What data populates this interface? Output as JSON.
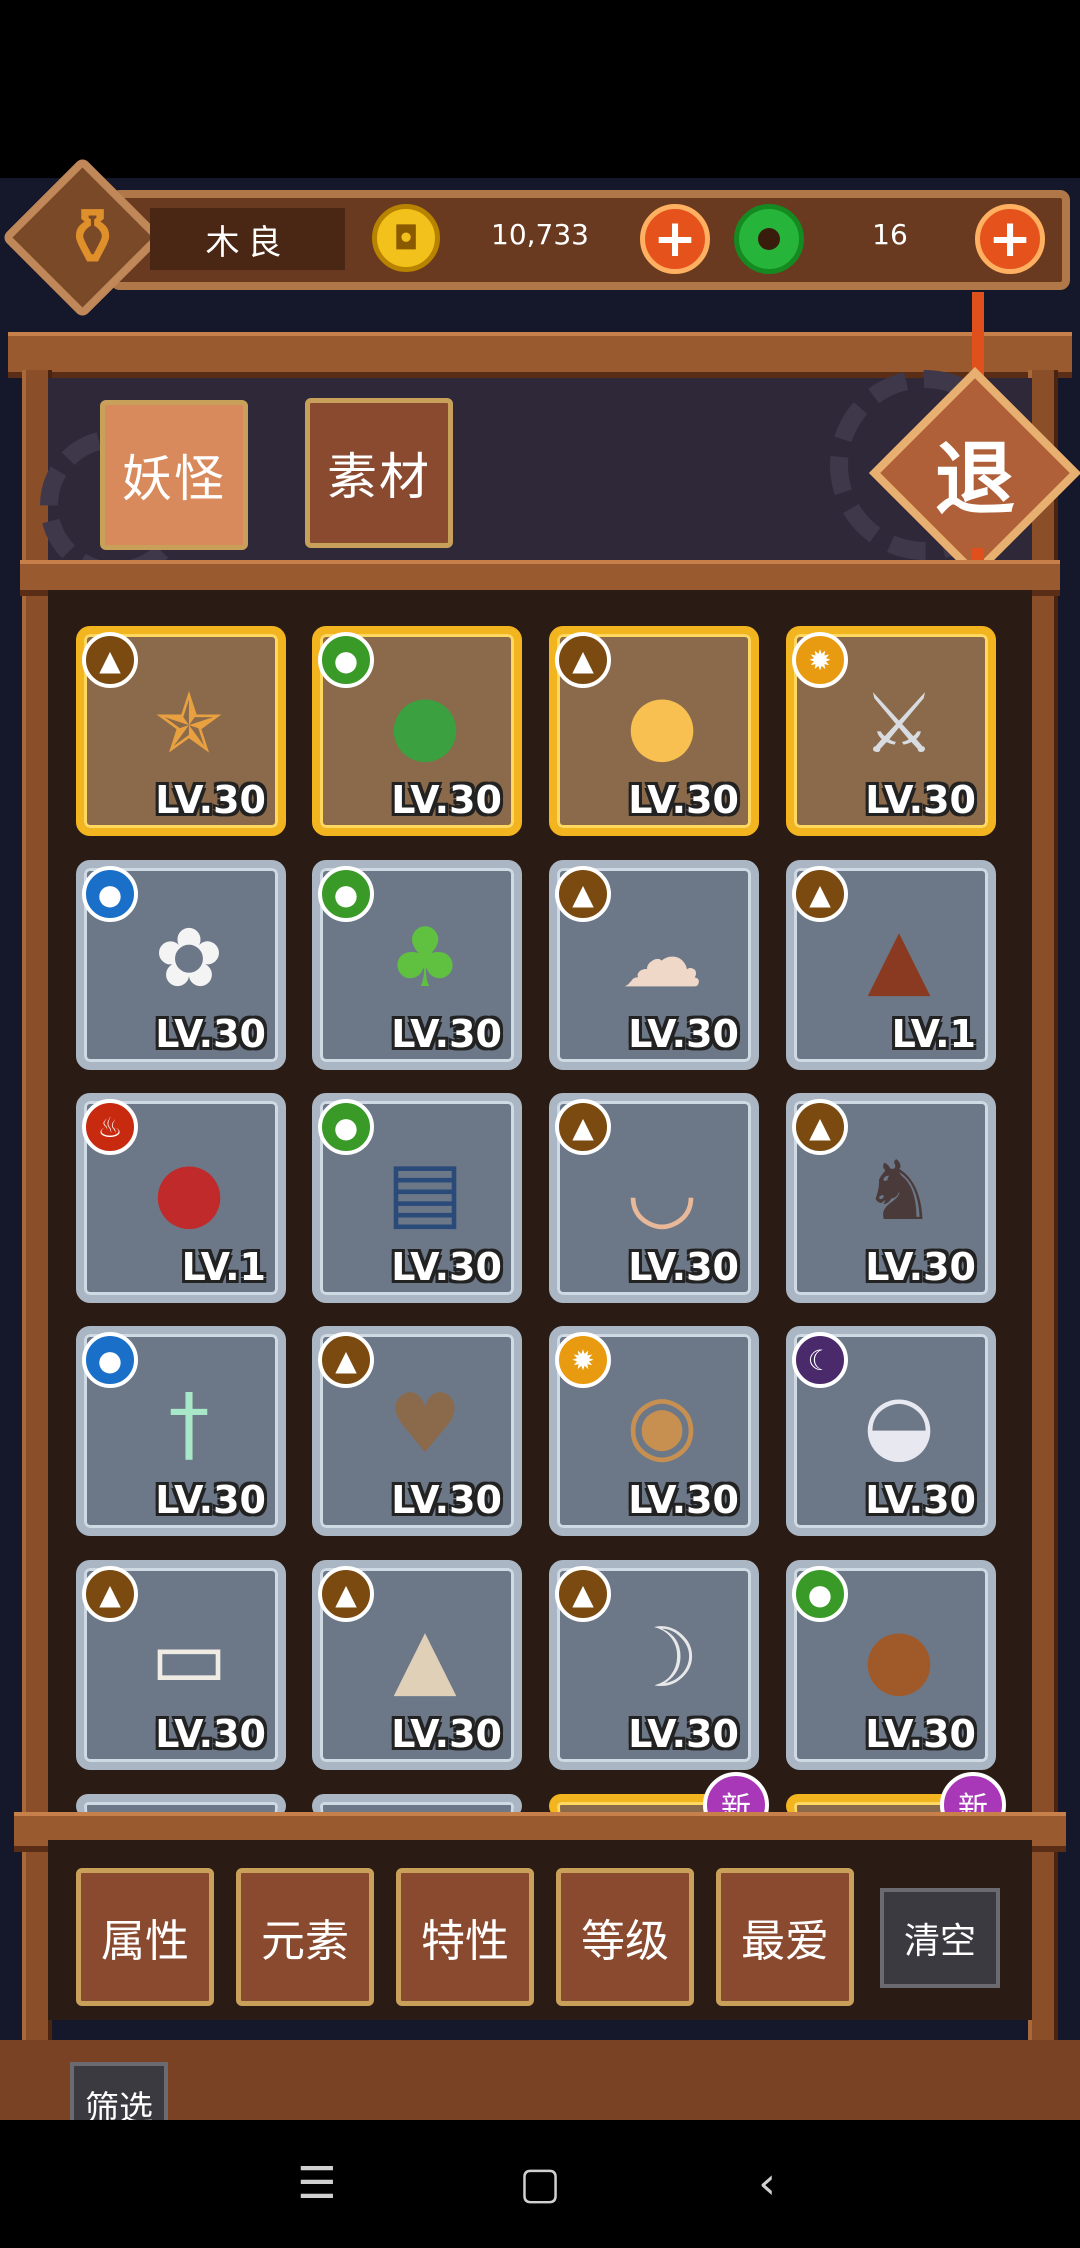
{
  "header": {
    "player_name": "木良",
    "coins": "10,733",
    "jade": "16",
    "add_coins_label": "+",
    "add_jade_label": "+"
  },
  "tabs": [
    {
      "label": "妖怪",
      "active": true
    },
    {
      "label": "素材",
      "active": false
    }
  ],
  "exit_label": "退",
  "cards": [
    {
      "element": "earth",
      "element_glyph": "▲",
      "sprite_glyph": "✯",
      "sprite_color": "#e8a040",
      "level": "LV.30",
      "frame": "gold"
    },
    {
      "element": "wood",
      "element_glyph": "●",
      "sprite_glyph": "●",
      "sprite_color": "#3aa040",
      "level": "LV.30",
      "frame": "gold"
    },
    {
      "element": "earth",
      "element_glyph": "▲",
      "sprite_glyph": "●",
      "sprite_color": "#f8c050",
      "level": "LV.30",
      "frame": "gold"
    },
    {
      "element": "sun",
      "element_glyph": "✹",
      "sprite_glyph": "⚔",
      "sprite_color": "#d8dce0",
      "level": "LV.30",
      "frame": "gold"
    },
    {
      "element": "water",
      "element_glyph": "●",
      "sprite_glyph": "✿",
      "sprite_color": "#f4f4f4",
      "level": "LV.30",
      "frame": "silver"
    },
    {
      "element": "wood",
      "element_glyph": "●",
      "sprite_glyph": "♣",
      "sprite_color": "#60c040",
      "level": "LV.30",
      "frame": "silver"
    },
    {
      "element": "earth",
      "element_glyph": "▲",
      "sprite_glyph": "☁",
      "sprite_color": "#f0d8c8",
      "level": "LV.30",
      "frame": "silver"
    },
    {
      "element": "earth",
      "element_glyph": "▲",
      "sprite_glyph": "▲",
      "sprite_color": "#8a3a20",
      "level": "LV.1",
      "frame": "silver"
    },
    {
      "element": "fire",
      "element_glyph": "♨",
      "sprite_glyph": "●",
      "sprite_color": "#c02a2a",
      "level": "LV.1",
      "frame": "silver"
    },
    {
      "element": "wood",
      "element_glyph": "●",
      "sprite_glyph": "▤",
      "sprite_color": "#2a4a7a",
      "level": "LV.30",
      "frame": "silver"
    },
    {
      "element": "earth",
      "element_glyph": "▲",
      "sprite_glyph": "◡",
      "sprite_color": "#e8b898",
      "level": "LV.30",
      "frame": "silver"
    },
    {
      "element": "earth",
      "element_glyph": "▲",
      "sprite_glyph": "♞",
      "sprite_color": "#4a3a3a",
      "level": "LV.30",
      "frame": "silver"
    },
    {
      "element": "water",
      "element_glyph": "●",
      "sprite_glyph": "†",
      "sprite_color": "#a8e8c8",
      "level": "LV.30",
      "frame": "silver"
    },
    {
      "element": "earth",
      "element_glyph": "▲",
      "sprite_glyph": "♥",
      "sprite_color": "#8a6a4a",
      "level": "LV.30",
      "frame": "silver"
    },
    {
      "element": "sun",
      "element_glyph": "✹",
      "sprite_glyph": "◉",
      "sprite_color": "#c89050",
      "level": "LV.30",
      "frame": "silver"
    },
    {
      "element": "moon",
      "element_glyph": "☾",
      "sprite_glyph": "◒",
      "sprite_color": "#e8e8f0",
      "level": "LV.30",
      "frame": "silver"
    },
    {
      "element": "earth",
      "element_glyph": "▲",
      "sprite_glyph": "▭",
      "sprite_color": "#f0ece4",
      "level": "LV.30",
      "frame": "silver"
    },
    {
      "element": "earth",
      "element_glyph": "▲",
      "sprite_glyph": "▲",
      "sprite_color": "#e0d0b8",
      "level": "LV.30",
      "frame": "silver"
    },
    {
      "element": "earth",
      "element_glyph": "▲",
      "sprite_glyph": "☽",
      "sprite_color": "#e8e8e8",
      "level": "LV.30",
      "frame": "silver"
    },
    {
      "element": "wood",
      "element_glyph": "●",
      "sprite_glyph": "●",
      "sprite_color": "#a05a2a",
      "level": "LV.30",
      "frame": "silver"
    }
  ],
  "partial_row": [
    {
      "new_badge": ""
    },
    {
      "new_badge": ""
    },
    {
      "new_badge": "新"
    },
    {
      "new_badge": "新"
    }
  ],
  "filters": [
    {
      "label": "属性"
    },
    {
      "label": "元素"
    },
    {
      "label": "特性"
    },
    {
      "label": "等级"
    },
    {
      "label": "最爱"
    }
  ],
  "clear_label": "清空",
  "screen_label": "筛选",
  "navbar": {
    "menu_glyph": "☰",
    "home_glyph": "▢",
    "back_glyph": "‹"
  }
}
